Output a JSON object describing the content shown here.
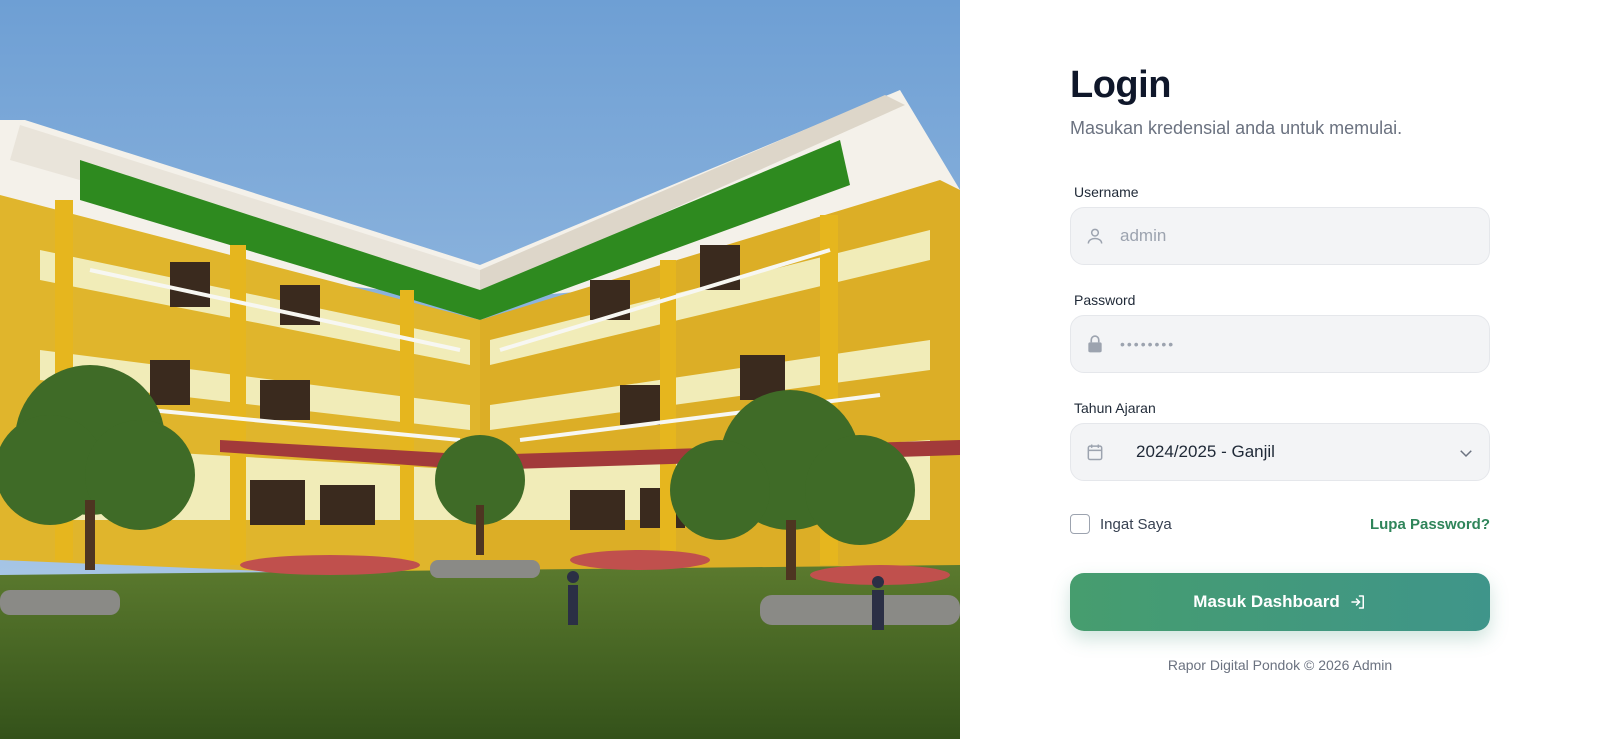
{
  "hero": {
    "image_description_icon": "school-building-image"
  },
  "login": {
    "title": "Login",
    "subtitle": "Masukan kredensial anda untuk memulai.",
    "username": {
      "label": "Username",
      "placeholder": "admin",
      "icon": "user-icon"
    },
    "password": {
      "label": "Password",
      "masked_value": "••••••••",
      "icon": "lock-icon"
    },
    "academic_year": {
      "label": "Tahun Ajaran",
      "selected": "2024/2025 - Ganjil",
      "icon": "calendar-icon"
    },
    "remember_me": {
      "label": "Ingat Saya",
      "checked": false
    },
    "forgot_password": "Lupa Password?",
    "submit": {
      "label": "Masuk Dashboard",
      "icon": "sign-in-icon"
    },
    "footer": "Rapor Digital Pondok © 2026 Admin"
  },
  "colors": {
    "accent": "#469d6e",
    "accent_end": "#3f958a",
    "link": "#2f855a",
    "title": "#0f172a",
    "muted": "#6b7280"
  }
}
